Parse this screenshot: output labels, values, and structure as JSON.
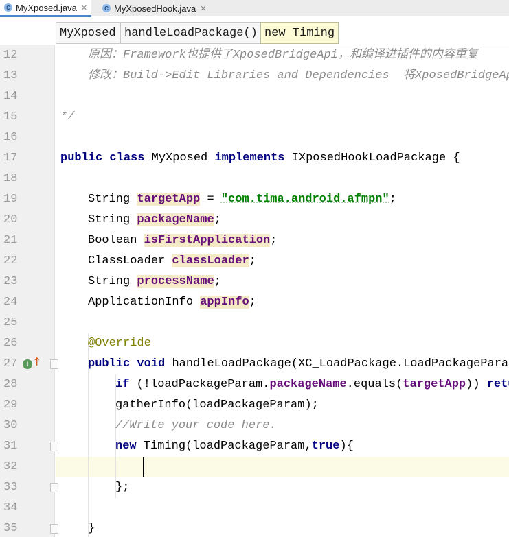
{
  "tabs": [
    {
      "icon": "class-icon",
      "label": "MyXposed.java",
      "active": true
    },
    {
      "icon": "class-icon",
      "label": "MyXposedHook.java",
      "active": false
    }
  ],
  "breadcrumb": [
    "MyXposed",
    "handleLoadPackage()",
    "new Timing"
  ],
  "line_numbers": [
    "12",
    "13",
    "14",
    "15",
    "16",
    "17",
    "18",
    "19",
    "20",
    "21",
    "22",
    "23",
    "24",
    "25",
    "26",
    "27",
    "28",
    "29",
    "30",
    "31",
    "32",
    "33",
    "34",
    "35"
  ],
  "code": {
    "l12": "原因：Framework也提供了XposedBridgeApi，和编译进插件的内容重复",
    "l13": "修改：Build->Edit Libraries and Dependencies  将XposedBridgeApi",
    "l15": "*/",
    "l17_kw1": "public",
    "l17_kw2": "class",
    "l17_name": "MyXposed",
    "l17_kw3": "implements",
    "l17_rest": "IXposedHookLoadPackage {",
    "l19_type": "String",
    "l19_field": "targetApp",
    "l19_eq": " = ",
    "l19_str": "\"com.tima.android.afmpn\"",
    "l19_end": ";",
    "l20_type": "String",
    "l20_field": "packageName",
    "l21_type": "Boolean",
    "l21_field": "isFirstApplication",
    "l22_type": "ClassLoader",
    "l22_field": "classLoader",
    "l23_type": "String",
    "l23_field": "processName",
    "l24_type": "ApplicationInfo",
    "l24_field": "appInfo",
    "semi": ";",
    "l26": "@Override",
    "l27_kw1": "public",
    "l27_kw2": "void",
    "l27_rest": "handleLoadPackage(XC_LoadPackage.LoadPackageParam",
    "l28_kw": "if",
    "l28_a": " (!loadPackageParam.",
    "l28_f1": "packageName",
    "l28_b": ".equals(",
    "l28_f2": "targetApp",
    "l28_c": ")) ",
    "l28_kw2": "return",
    "l29": "gatherInfo(loadPackageParam);",
    "l30": "//Write your code here.",
    "l31_kw": "new",
    "l31_a": " Timing(loadPackageParam,",
    "l31_kw2": "true",
    "l31_b": "){",
    "l33": "};",
    "l35": "}"
  },
  "colors": {
    "keyword": "#000080",
    "field": "#660e7a",
    "string": "#008000",
    "comment": "#8c8c8c",
    "annotation": "#808000",
    "current_line": "#fcfbe6"
  },
  "gutter_icons": {
    "line27": [
      "implements-method-icon",
      "override-up-arrow-icon"
    ]
  }
}
